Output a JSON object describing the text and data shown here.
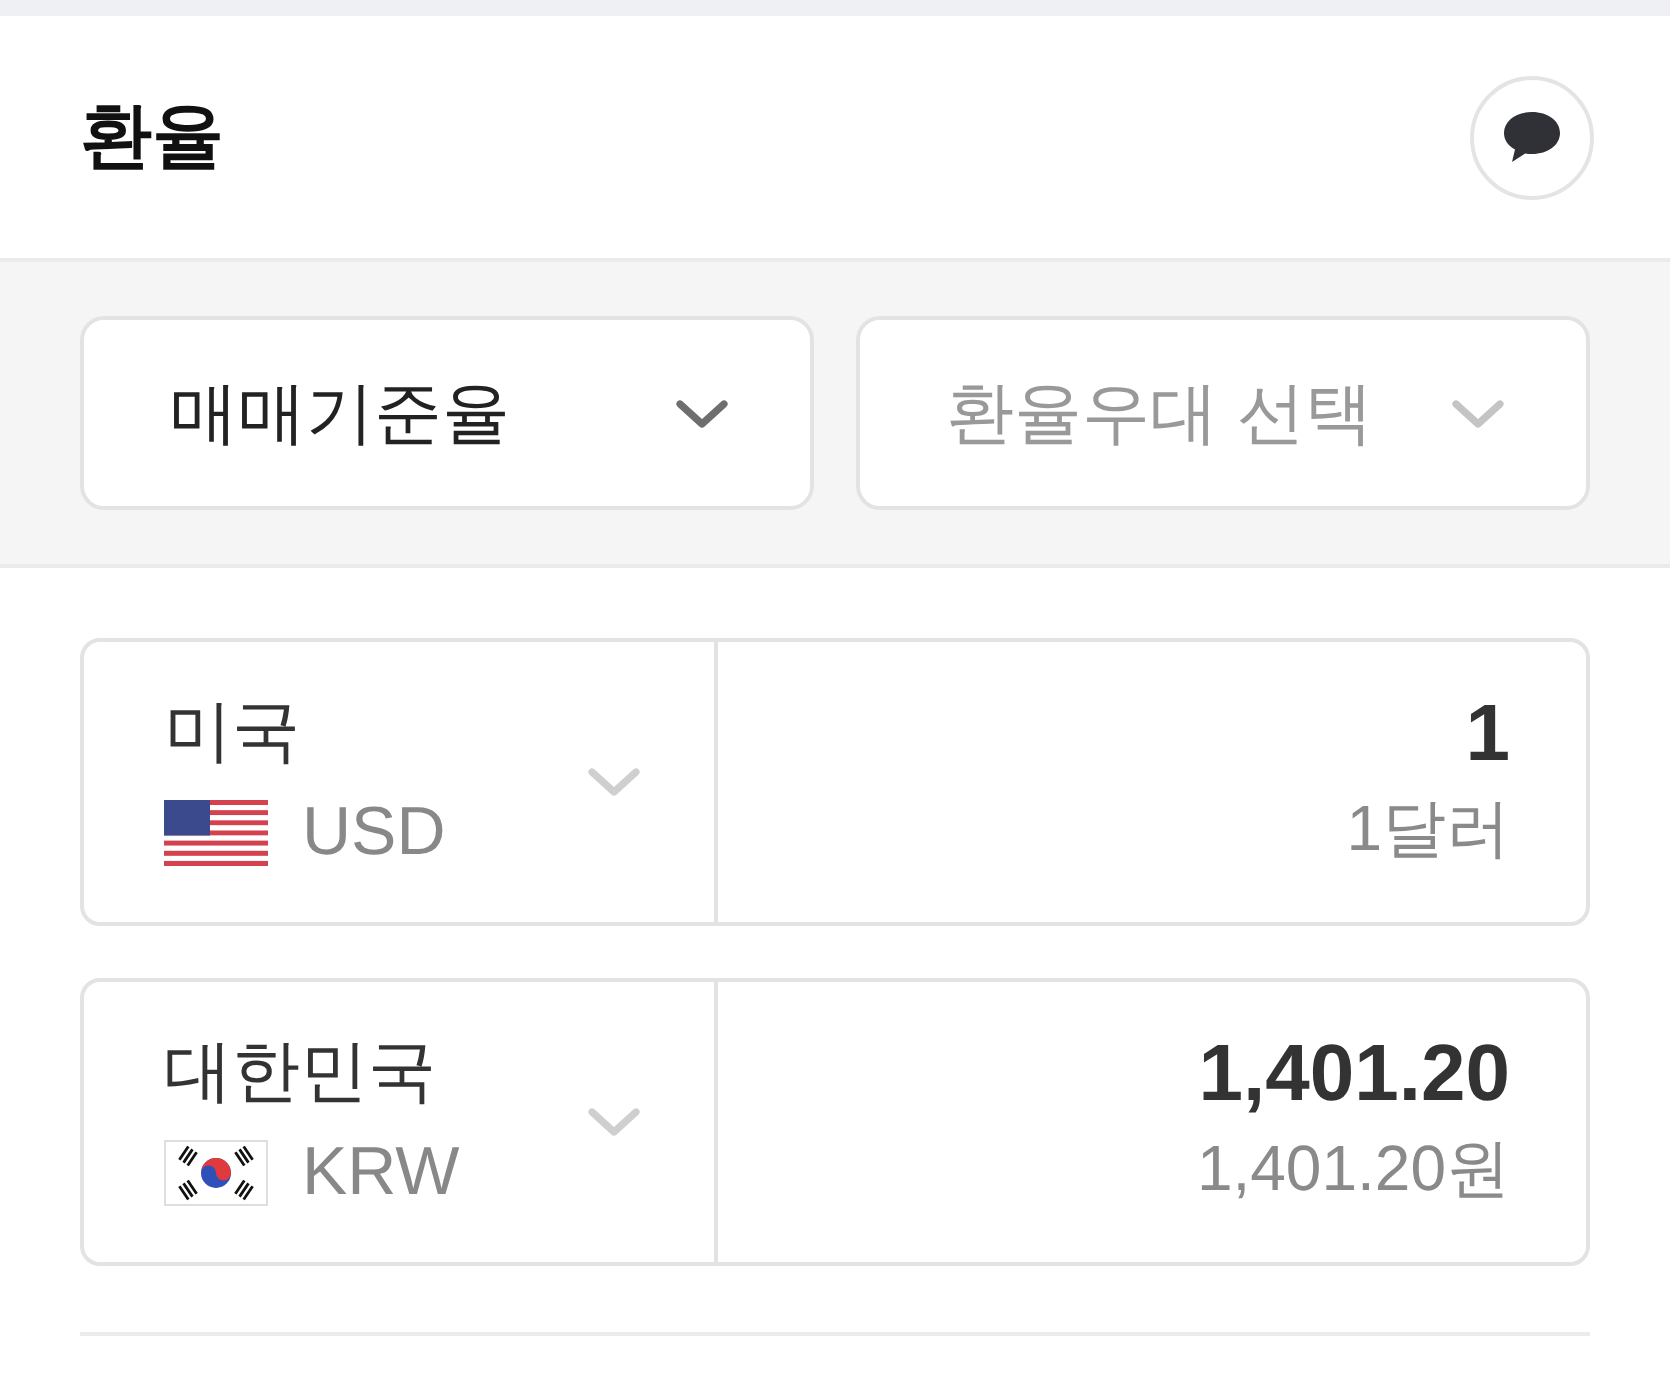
{
  "top_bar": {
    "title": "환율"
  },
  "rate_options": [
    {
      "value": "매매기준율"
    },
    {
      "placeholder": "환율우대 선택"
    }
  ],
  "converters": [
    {
      "kind": "us",
      "country": "미국",
      "code": "USD",
      "amount": "1",
      "amount_words": "1달러"
    },
    {
      "kind": "kr",
      "country": "대한민국",
      "code": "KRW",
      "amount": "1,401.20",
      "amount_words": "1,401.20원"
    }
  ]
}
